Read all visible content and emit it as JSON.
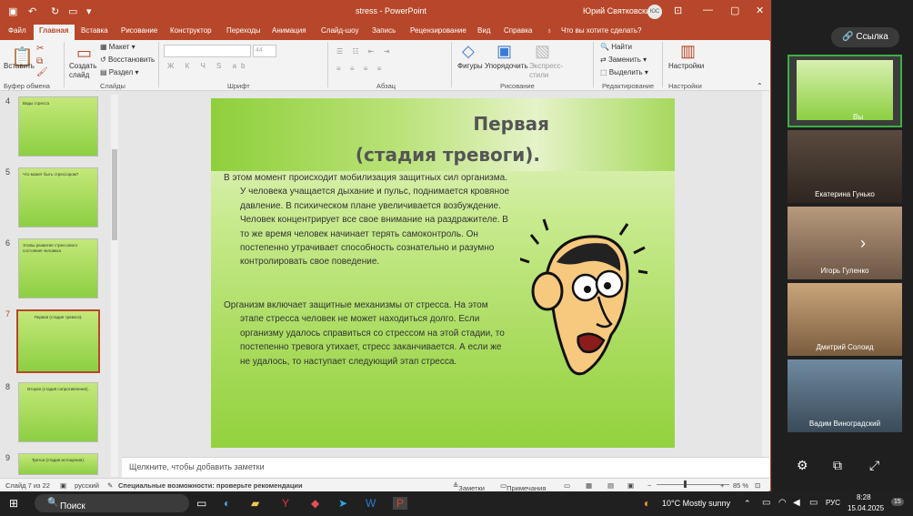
{
  "window": {
    "title": "stress - PowerPoint",
    "user": "Юрий Святковский",
    "user_initials": "ЮС",
    "accent": "#b7472a"
  },
  "tabs": [
    "Файл",
    "Главная",
    "Вставка",
    "Рисование",
    "Конструктор",
    "Переходы",
    "Анимация",
    "Слайд-шоу",
    "Запись",
    "Рецензирование",
    "Вид",
    "Справка",
    "Что вы хотите сделать?"
  ],
  "ribbon": {
    "paste": "Вставить",
    "clipboard_group": "Буфер обмена",
    "new_slide": "Создать слайд",
    "layout": "Макет",
    "reset": "Восстановить",
    "section": "Раздел",
    "slides_group": "Слайды",
    "font_size": "44",
    "font_group": "Шрифт",
    "paragraph_group": "Абзац",
    "shapes": "Фигуры",
    "arrange": "Упорядочить",
    "quick_styles": "Экспресс-стили",
    "drawing_group": "Рисование",
    "find": "Найти",
    "replace": "Заменить",
    "select": "Выделить",
    "editing_group": "Редактирование",
    "designer": "Настройки",
    "designer_group": "Настройки"
  },
  "thumbnails": [
    {
      "num": "4",
      "title": "Виды стресса"
    },
    {
      "num": "5",
      "title": "Что может быть стрессором?"
    },
    {
      "num": "6",
      "title": "Этапы развития стрессового состояния человека"
    },
    {
      "num": "7",
      "title": "Первая (стадия тревоги)."
    },
    {
      "num": "8",
      "title": "Вторая (стадия сопротивления)."
    },
    {
      "num": "9",
      "title": "Третья (стадия истощения)."
    }
  ],
  "slide": {
    "title_line1": "Первая",
    "title_line2": "(стадия тревоги).",
    "paragraph1": "В этом момент происходит мобилизация защитных сил организма. У человека учащается дыхание и пульс, поднимается кровяное давление. В психическом плане увеличивается возбуждение. Человек концентрирует все свое внимание на раздражителе. В то же время человек начинает терять самоконтроль. Он постепенно утрачивает способность сознательно и разумно контролировать свое поведение.",
    "paragraph2": "Организм включает защитные механизмы от стресса. На этом этапе стресса человек не может находиться долго. Если организму удалось справиться со стрессом на этой стадии, то постепенно тревога утихает, стресс заканчивается. А если же не удалось, то наступает следующий этап стресса."
  },
  "notes_placeholder": "Щелкните, чтобы добавить заметки",
  "status": {
    "slide_counter": "Слайд 7 из 22",
    "language": "русский",
    "accessibility": "Специальные возможности: проверьте рекомендации",
    "notes": "Заметки",
    "comments": "Примечания",
    "zoom": "85 %"
  },
  "video": {
    "link_button": "Ссылка",
    "self_label": "Вы",
    "participants": [
      "Екатерина Гунько",
      "Игорь Гуленко",
      "Дмитрий Солоид",
      "Вадим Виноградский"
    ]
  },
  "taskbar": {
    "search": "Поиск",
    "weather": "10°C  Mostly sunny",
    "lang": "РУС",
    "time": "8:28",
    "date": "15.04.2025",
    "notif": "15"
  }
}
